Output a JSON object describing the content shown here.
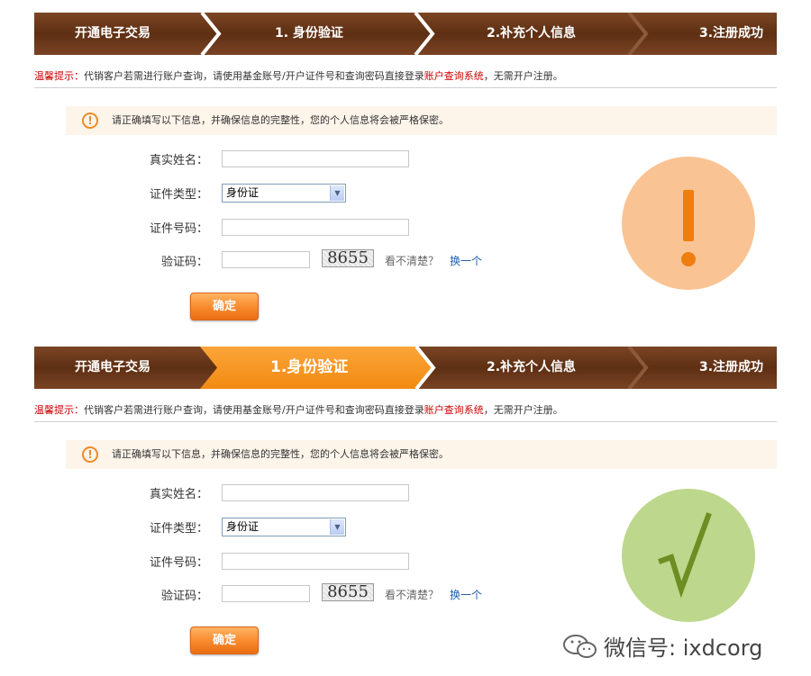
{
  "steps": [
    "开通电子交易",
    "1. 身份验证",
    "2.补充个人信息",
    "3.注册成功"
  ],
  "steps_active": [
    "开通电子交易",
    "1.身份验证",
    "2.补充个人信息",
    "3.注册成功"
  ],
  "tip": {
    "label": "温馨提示：",
    "text_before": "代销客户若需进行账户查询，请使用基金账号/开户证件号和查询密码直接登录",
    "link": "账户查询系统",
    "text_after": "，无需开户注册。"
  },
  "notice": {
    "icon": "!",
    "text": "请正确填写以下信息，并确保信息的完整性，您的个人信息将会被严格保密。"
  },
  "form": {
    "name_label": "真实姓名：",
    "name_value": "",
    "id_type_label": "证件类型：",
    "id_type_value": "身份证",
    "id_number_label": "证件号码：",
    "id_number_value": "",
    "captcha_label": "验证码：",
    "captcha_value": "",
    "captcha_text": "8655",
    "unclear": "看不清楚？",
    "change": "换一个",
    "submit": "确定"
  },
  "status": {
    "warn_symbol": "!",
    "ok_symbol": "√"
  },
  "colors": {
    "stepbar_brown": "#5a2e12",
    "active_step_orange": "#f7941d",
    "warn_circle": "#f9c393",
    "warn_mark": "#ef7d10",
    "ok_circle": "#bdd78c",
    "ok_mark": "#6c8e23",
    "link_blue": "#1e5eb3",
    "tip_red": "#cc0000"
  },
  "watermark": {
    "icon": "wechat-icon",
    "text": "微信号: ixdcorg"
  }
}
